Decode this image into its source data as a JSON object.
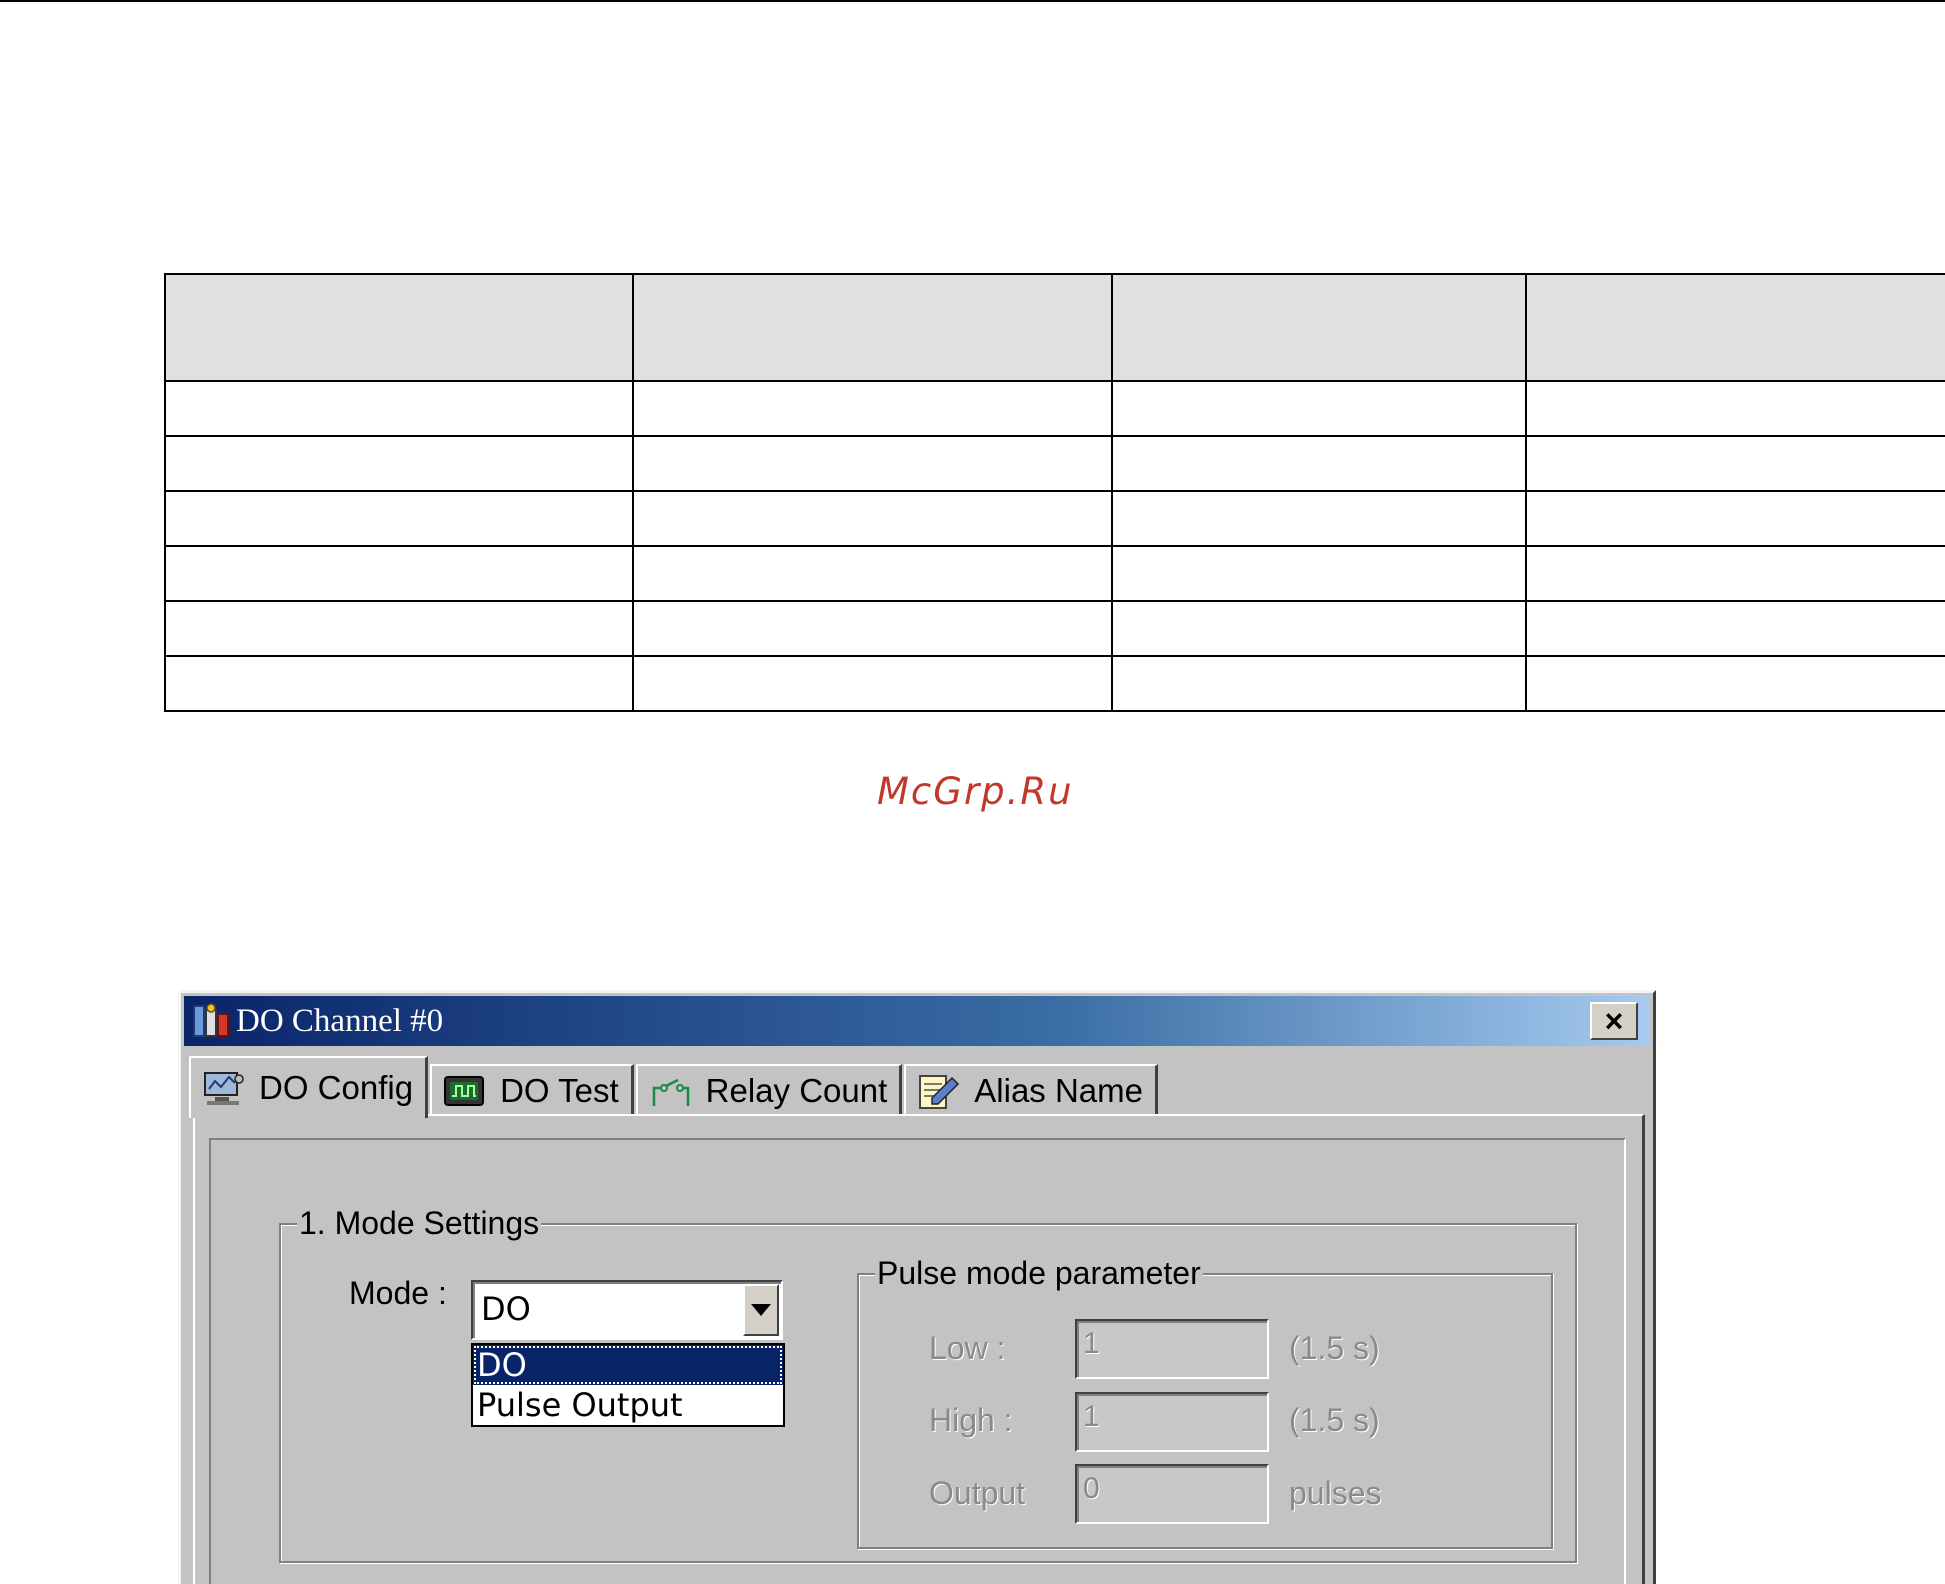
{
  "watermark": "McGrp.Ru",
  "table": {
    "header": [
      "",
      "",
      "",
      ""
    ],
    "rows": [
      [
        "",
        "",
        "",
        ""
      ],
      [
        "",
        "",
        "",
        ""
      ],
      [
        "",
        "",
        "",
        ""
      ],
      [
        "",
        "",
        "",
        ""
      ],
      [
        "",
        "",
        "",
        ""
      ],
      [
        "",
        "",
        "",
        ""
      ]
    ]
  },
  "dialog": {
    "title": "DO Channel #0",
    "close_label": "×",
    "tabs": [
      {
        "label": "DO Config",
        "icon": "config-icon",
        "active": true
      },
      {
        "label": "DO Test",
        "icon": "oscilloscope-icon",
        "active": false
      },
      {
        "label": "Relay Count",
        "icon": "relay-icon",
        "active": false
      },
      {
        "label": "Alias Name",
        "icon": "notepad-pencil-icon",
        "active": false
      }
    ],
    "mode_settings": {
      "legend": "1. Mode Settings",
      "mode_label": "Mode :",
      "mode_value": "DO",
      "mode_options": [
        "DO",
        "Pulse Output"
      ],
      "selected_option": "DO"
    },
    "pulse": {
      "legend": "Pulse mode parameter",
      "low_label": "Low :",
      "low_value": "1",
      "low_unit": "(1.5 s)",
      "high_label": "High :",
      "high_value": "1",
      "high_unit": "(1.5 s)",
      "output_label": "Output",
      "output_value": "0",
      "output_unit": "pulses"
    }
  }
}
